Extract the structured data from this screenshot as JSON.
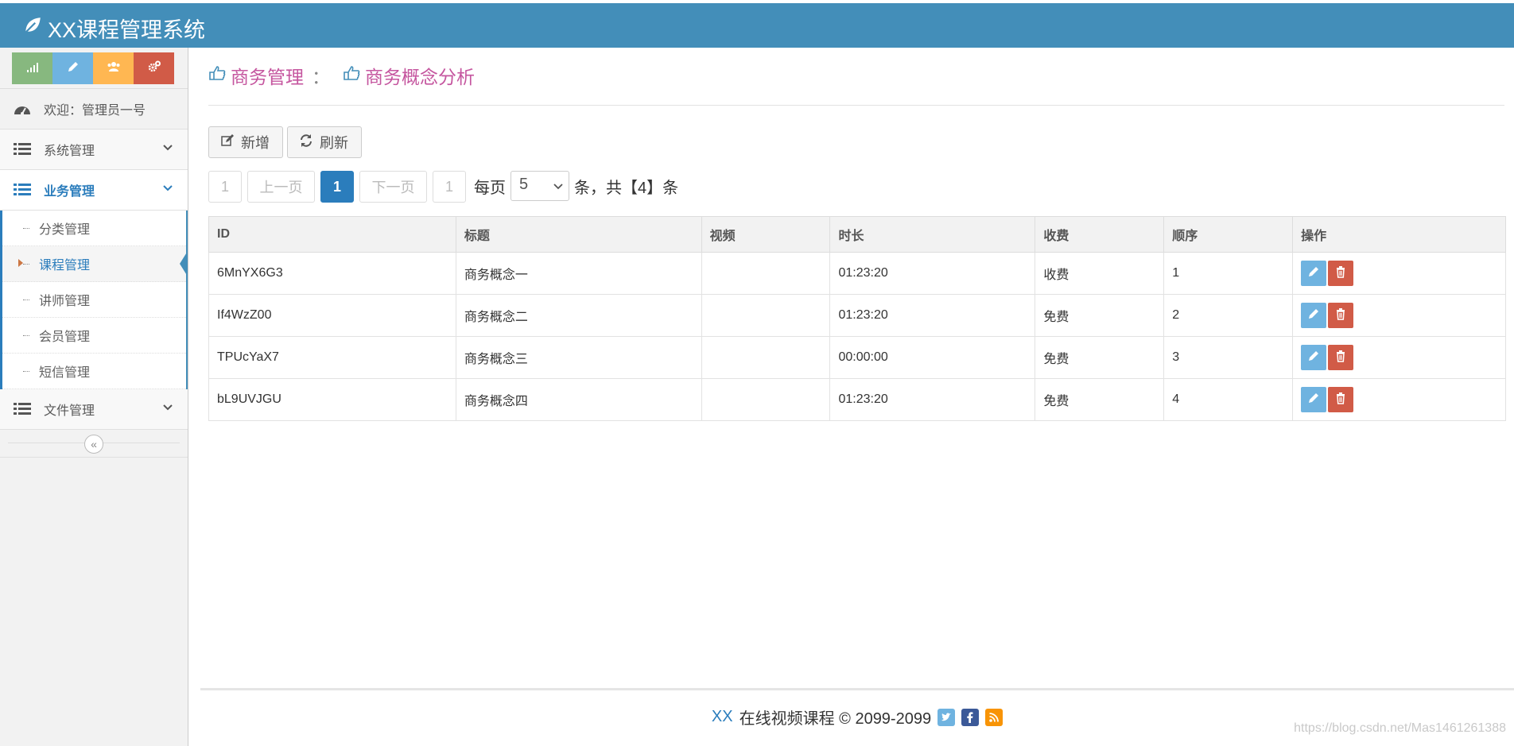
{
  "app": {
    "title": "XX课程管理系统"
  },
  "shortcuts": [
    {
      "icon": "signal-icon",
      "color": "#87b87f"
    },
    {
      "icon": "pencil-icon",
      "color": "#6fb3e0"
    },
    {
      "icon": "users-icon",
      "color": "#ffb752"
    },
    {
      "icon": "cogs-icon",
      "color": "#d15b47"
    }
  ],
  "sidebar": {
    "welcome": "欢迎：管理员一号",
    "menus": [
      {
        "label": "系统管理"
      },
      {
        "label": "业务管理"
      },
      {
        "label": "文件管理"
      }
    ],
    "submenu": [
      {
        "label": "分类管理"
      },
      {
        "label": "课程管理"
      },
      {
        "label": "讲师管理"
      },
      {
        "label": "会员管理"
      },
      {
        "label": "短信管理"
      }
    ]
  },
  "breadcrumb": {
    "parent": "商务管理",
    "separator": "：",
    "current": "商务概念分析"
  },
  "toolbar": {
    "add_label": "新增",
    "refresh_label": "刷新"
  },
  "pagination": {
    "first": "1",
    "prev": "上一页",
    "current": "1",
    "next": "下一页",
    "last": "1",
    "per_page_label": "每页",
    "per_page_value": "5",
    "total_text": "条，共【4】条"
  },
  "table": {
    "headers": [
      "ID",
      "标题",
      "视频",
      "时长",
      "收费",
      "顺序",
      "操作"
    ],
    "rows": [
      {
        "id": "6MnYX6G3",
        "title": "商务概念一",
        "video": "",
        "duration": "01:23:20",
        "charge": "收费",
        "order": "1"
      },
      {
        "id": "If4WzZ00",
        "title": "商务概念二",
        "video": "",
        "duration": "01:23:20",
        "charge": "免费",
        "order": "2"
      },
      {
        "id": "TPUcYaX7",
        "title": "商务概念三",
        "video": "",
        "duration": "00:00:00",
        "charge": "免费",
        "order": "3"
      },
      {
        "id": "bL9UVJGU",
        "title": "商务概念四",
        "video": "",
        "duration": "01:23:20",
        "charge": "免费",
        "order": "4"
      }
    ]
  },
  "footer": {
    "brand": "XX",
    "text": "在线视频课程 © 2099-2099"
  },
  "watermark": "https://blog.csdn.net/Mas1461261388",
  "colors": {
    "header": "#438eb9",
    "accent": "#2b7dbc",
    "edit": "#6fb3e0",
    "delete": "#d15b47",
    "breadcrumb": "#c5569f"
  }
}
